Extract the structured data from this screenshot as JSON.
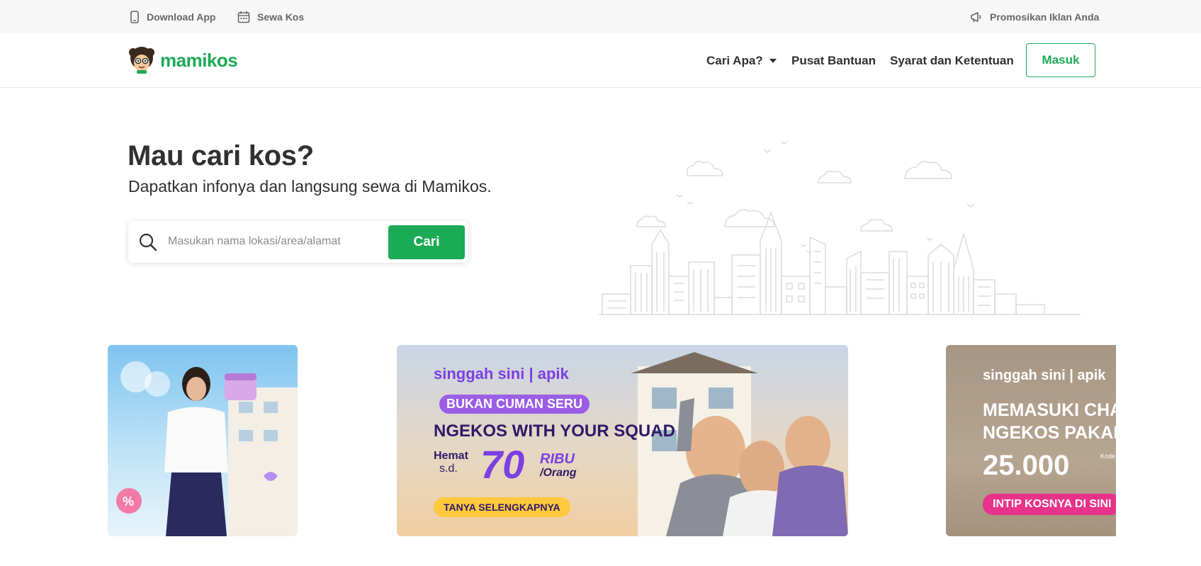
{
  "topbar": {
    "download_app": "Download App",
    "sewa_kos": "Sewa Kos",
    "promote": "Promosikan Iklan Anda"
  },
  "navbar": {
    "logo": "mamikos",
    "cari_apa": "Cari Apa?",
    "pusat_bantuan": "Pusat Bantuan",
    "syarat": "Syarat dan Ketentuan",
    "masuk": "Masuk"
  },
  "hero": {
    "title": "Mau cari kos?",
    "subtitle": "Dapatkan infonya dan langsung sewa di Mamikos.",
    "search_placeholder": "Masukan nama lokasi/area/alamat",
    "search_button": "Cari"
  },
  "banners": {
    "b2": {
      "brand": "singgah sini | apik",
      "tag": "BUKAN CUMAN SERU",
      "headline": "NGEKOS WITH YOUR SQUAD",
      "hemat": "Hemat",
      "sd": "s.d.",
      "amount": "70",
      "unit": "RIBU",
      "per": "/Orang",
      "cta": "TANYA SELENGKAPNYA"
    },
    "b3": {
      "brand": "singgah sini | apik",
      "headline1": "MEMASUKI CHAPT",
      "headline2": "NGEKOS PAKAI V",
      "amount": "25.000",
      "kode": "Kode",
      "cta": "INTIP KOSNYA DI SINI"
    }
  },
  "colors": {
    "brand": "#1baa56",
    "text": "#303030",
    "topbar": "#f7f7f7"
  }
}
